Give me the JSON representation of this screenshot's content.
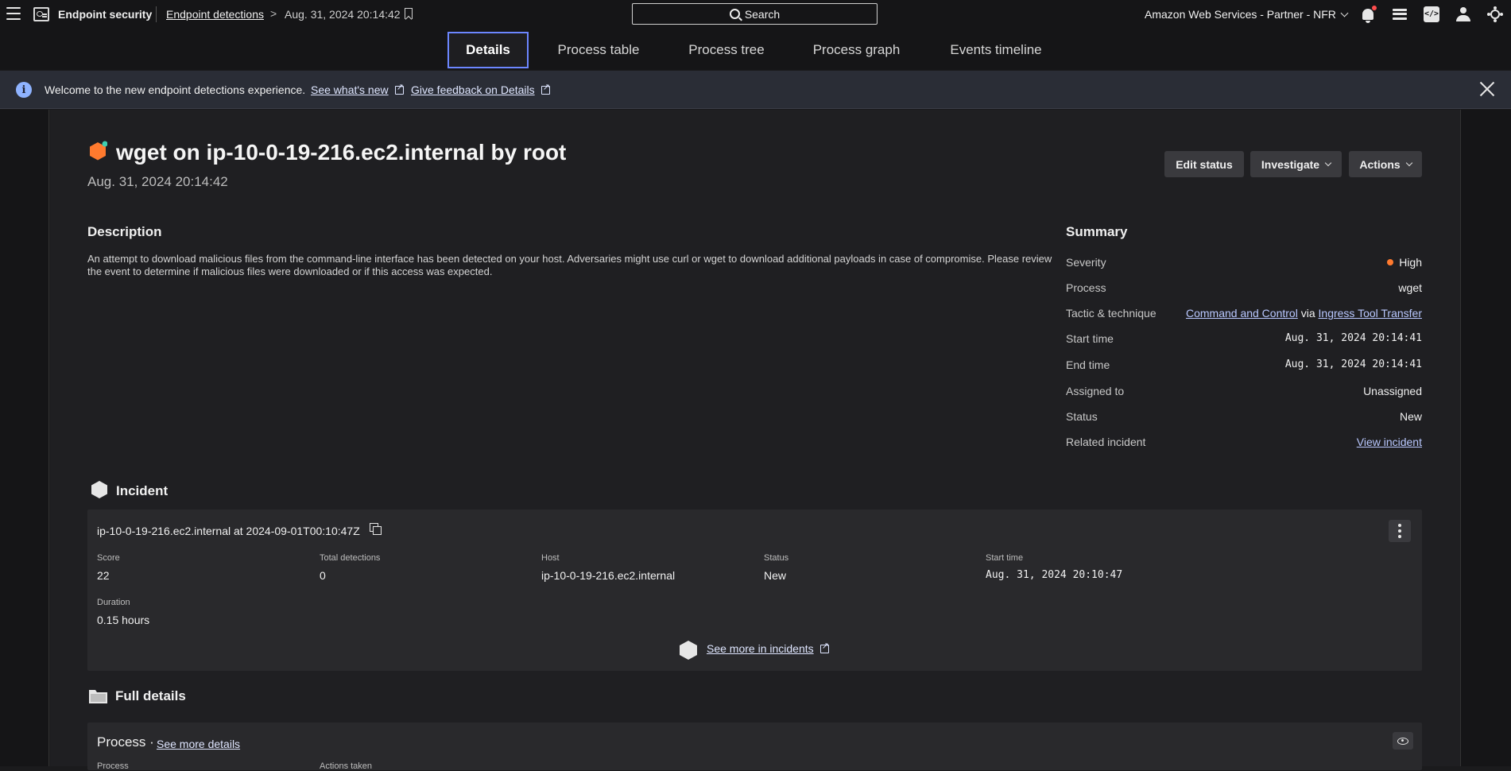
{
  "topbar": {
    "app_name": "Endpoint security",
    "breadcrumb_link": "Endpoint detections",
    "breadcrumb_sep": ">",
    "breadcrumb_current": "Aug. 31, 2024 20:14:42",
    "search_label": "Search",
    "account": "Amazon Web Services - Partner - NFR",
    "code_icon_text": "</>"
  },
  "tabs": [
    {
      "label": "Details",
      "active": true
    },
    {
      "label": "Process table"
    },
    {
      "label": "Process tree"
    },
    {
      "label": "Process graph"
    },
    {
      "label": "Events timeline"
    }
  ],
  "banner": {
    "info_glyph": "i",
    "text": "Welcome to the new endpoint detections experience.",
    "link1": "See what's new",
    "link2": "Give feedback on Details"
  },
  "detection": {
    "title": "wget on ip-10-0-19-216.ec2.internal by root",
    "date": "Aug. 31, 2024 20:14:42",
    "buttons": {
      "edit_status": "Edit status",
      "investigate": "Investigate",
      "actions": "Actions"
    },
    "accent_color": "#ff7a2e"
  },
  "description": {
    "heading": "Description",
    "text": "An attempt to download malicious files from the command-line interface has been detected on your host. Adversaries might use curl or wget to download additional payloads in case of compromise. Please review the event to determine if malicious files were downloaded or if this access was expected."
  },
  "summary": {
    "heading": "Summary",
    "severity_label": "Severity",
    "severity": "High",
    "process_label": "Process",
    "process": "wget",
    "tactic_label": "Tactic & technique",
    "tactic": "Command and Control",
    "via": "via",
    "technique": "Ingress Tool Transfer",
    "start_label": "Start time",
    "start": "Aug. 31, 2024 20:14:41",
    "end_label": "End time",
    "end": "Aug. 31, 2024 20:14:41",
    "assigned_label": "Assigned to",
    "assigned": "Unassigned",
    "status_label": "Status",
    "status": "New",
    "related_label": "Related incident",
    "related": "View incident"
  },
  "incident": {
    "heading": "Incident",
    "card_title": "ip-10-0-19-216.ec2.internal at 2024-09-01T00:10:47Z",
    "score_label": "Score",
    "score": "22",
    "total_label": "Total detections",
    "total": "0",
    "host_label": "Host",
    "host": "ip-10-0-19-216.ec2.internal",
    "status_label": "Status",
    "status": "New",
    "start_label": "Start time",
    "start": "Aug. 31, 2024 20:10:47",
    "duration_label": "Duration",
    "duration": "0.15 hours",
    "see_more": "See more in incidents"
  },
  "full_details": {
    "heading": "Full details",
    "process_heading": "Process",
    "separator": "·",
    "see_more": "See more details",
    "col1": "Process",
    "col2": "Actions taken"
  }
}
